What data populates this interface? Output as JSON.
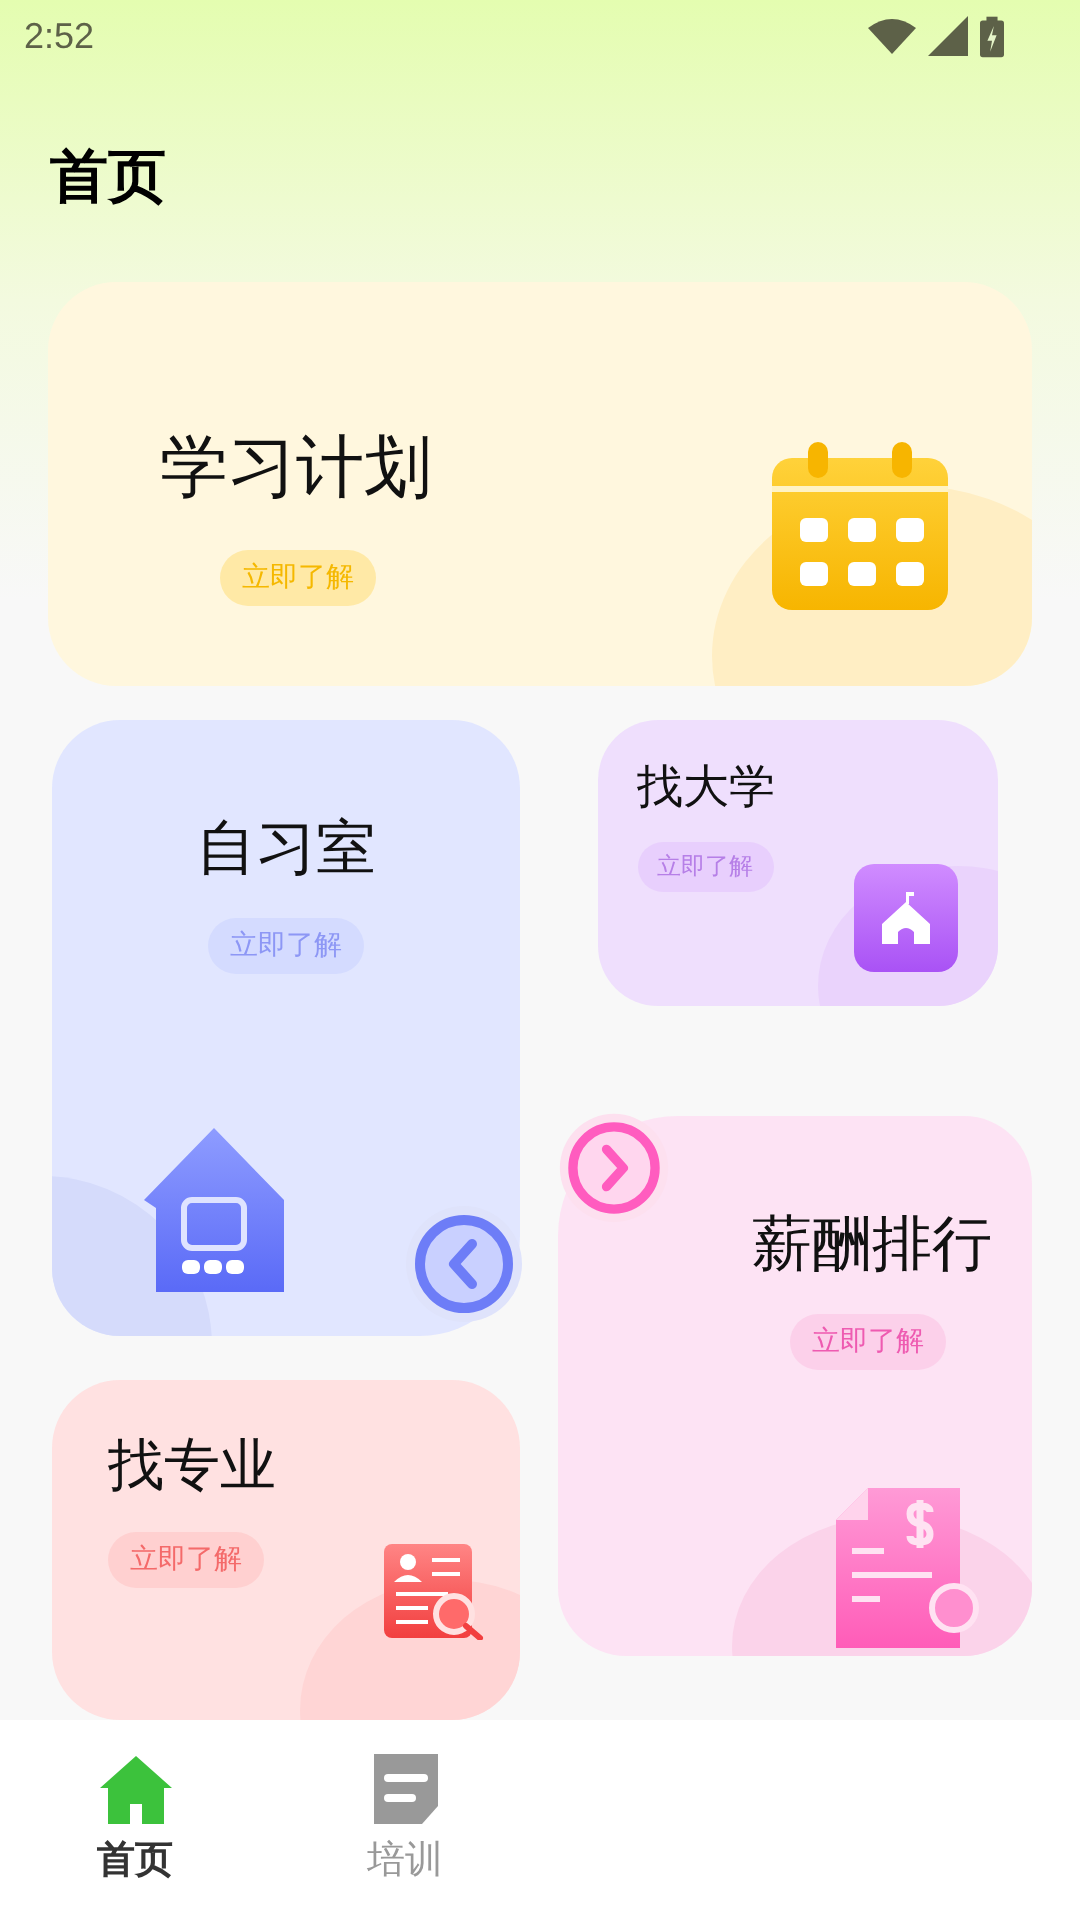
{
  "status_bar": {
    "time": "2:52"
  },
  "page_title": "首页",
  "cards": [
    {
      "kind": "plan",
      "title": "学习计划",
      "button": "立即了解"
    },
    {
      "kind": "study-room",
      "title": "自习室",
      "button": "立即了解"
    },
    {
      "kind": "major",
      "title": "找专业",
      "button": "立即了解"
    },
    {
      "kind": "university",
      "title": "找大学",
      "button": "立即了解"
    },
    {
      "kind": "salary",
      "title": "薪酬排行",
      "button": "立即了解"
    }
  ],
  "bottom_nav": [
    {
      "label": "首页",
      "selected": true
    },
    {
      "label": "培训",
      "selected": false
    }
  ]
}
